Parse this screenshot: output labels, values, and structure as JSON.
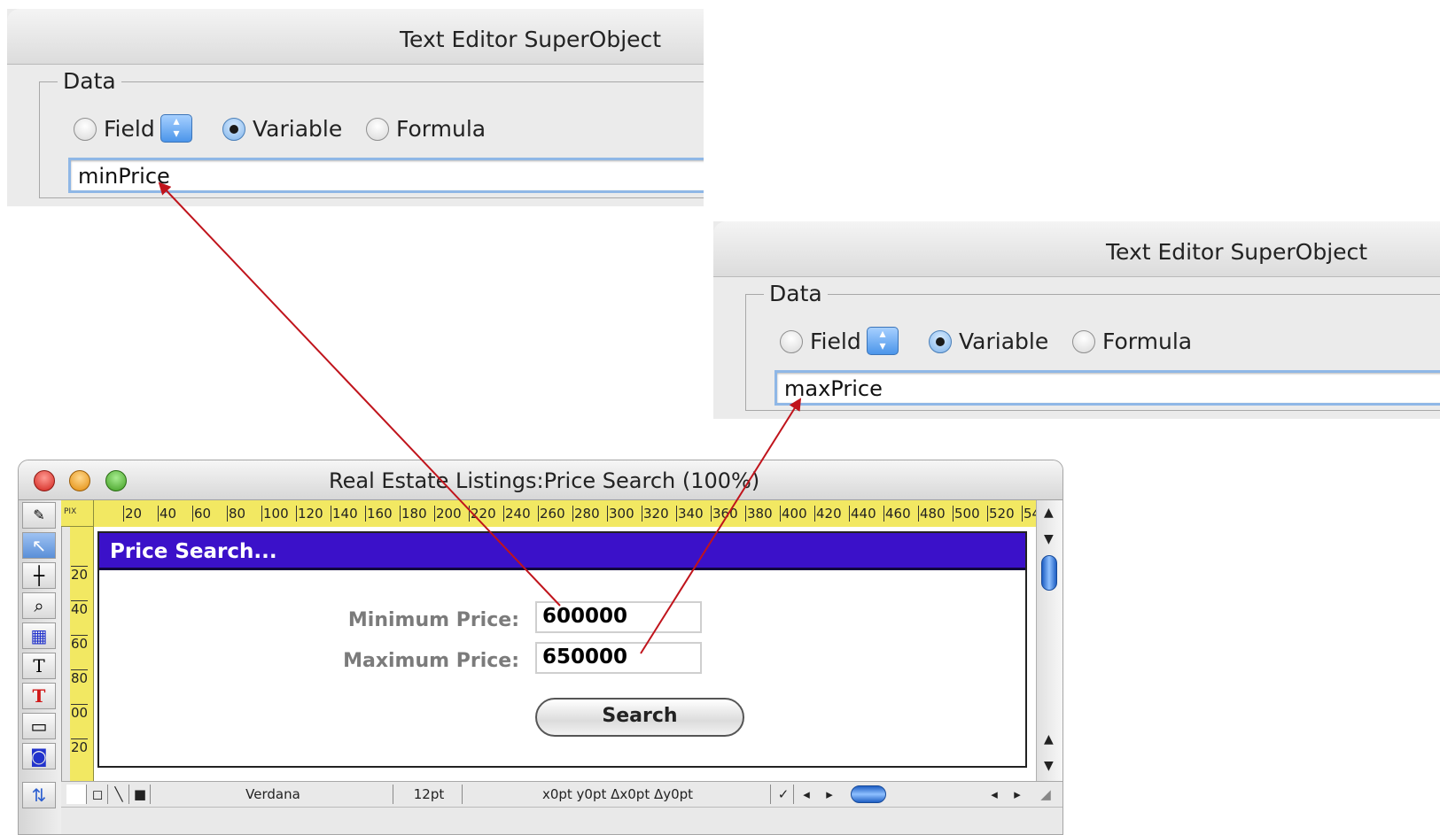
{
  "panel1": {
    "title": "Text Editor SuperObject",
    "group_label": "Data",
    "radio_field": "Field",
    "radio_variable": "Variable",
    "radio_formula": "Formula",
    "selected": "Variable",
    "input_value": "minPrice"
  },
  "panel2": {
    "title": "Text Editor SuperObject",
    "group_label": "Data",
    "radio_field": "Field",
    "radio_variable": "Variable",
    "radio_formula": "Formula",
    "selected": "Variable",
    "input_value": "maxPrice"
  },
  "window": {
    "title": "Real Estate Listings:Price Search (100%)",
    "ruler_unit": "PIX",
    "ruler_h_ticks": [
      "20",
      "40",
      "60",
      "80",
      "100",
      "120",
      "140",
      "160",
      "180",
      "200",
      "220",
      "240",
      "260",
      "280",
      "300",
      "320",
      "340",
      "360",
      "380",
      "400",
      "420",
      "440",
      "460",
      "480",
      "500",
      "520",
      "54"
    ],
    "ruler_v_ticks": [
      "20",
      "40",
      "60",
      "80",
      "00",
      "20"
    ]
  },
  "form": {
    "header": "Price Search...",
    "min_label": "Minimum Price:",
    "min_value": "600000",
    "max_label": "Maximum Price:",
    "max_value": "650000",
    "search_button": "Search"
  },
  "statusbar": {
    "font": "Verdana",
    "size": "12pt",
    "coords": "x0pt y0pt Δx0pt Δy0pt"
  },
  "colors": {
    "header_bg": "#3b11c9",
    "ruler_bg": "#f2e862",
    "arrow": "#c0141c"
  }
}
